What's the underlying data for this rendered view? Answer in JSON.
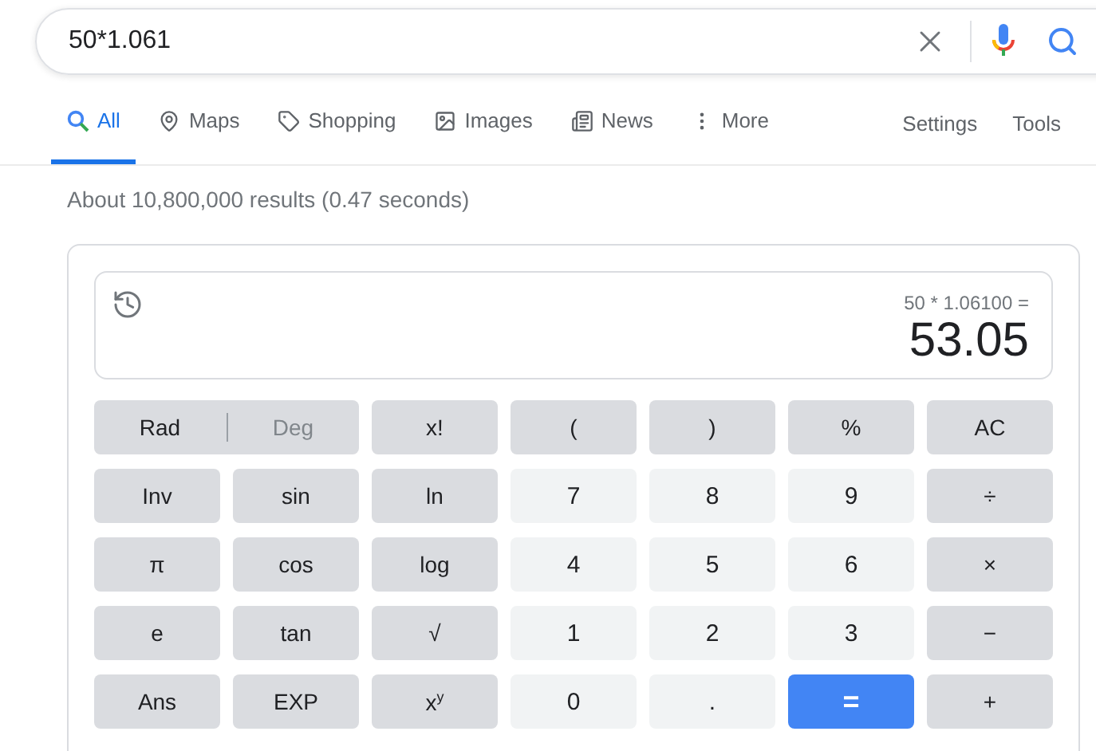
{
  "search": {
    "value": "50*1.061"
  },
  "tabs": [
    {
      "label": "All",
      "kind": "search",
      "selected": true
    },
    {
      "label": "Maps",
      "kind": "pin",
      "selected": false
    },
    {
      "label": "Shopping",
      "kind": "tag",
      "selected": false
    },
    {
      "label": "Images",
      "kind": "image",
      "selected": false
    },
    {
      "label": "News",
      "kind": "news",
      "selected": false
    },
    {
      "label": "More",
      "kind": "dots",
      "selected": false
    }
  ],
  "tools": [
    "Settings",
    "Tools"
  ],
  "result_stats": "About 10,800,000 results (0.47 seconds)",
  "calculator": {
    "expression": "50 * 1.06100 =",
    "result": "53.05",
    "keys": [
      {
        "kind": "angle",
        "options": [
          {
            "label": "Rad",
            "selected": true
          },
          {
            "label": "Deg",
            "selected": false
          }
        ]
      },
      {
        "kind": "fn",
        "label": "x!"
      },
      {
        "kind": "fn",
        "label": "("
      },
      {
        "kind": "fn",
        "label": ")"
      },
      {
        "kind": "fn",
        "label": "%"
      },
      {
        "kind": "fn",
        "label": "AC"
      },
      {
        "kind": "fn",
        "label": "Inv"
      },
      {
        "kind": "fn",
        "label": "sin"
      },
      {
        "kind": "fn",
        "label": "ln"
      },
      {
        "kind": "num",
        "label": "7"
      },
      {
        "kind": "num",
        "label": "8"
      },
      {
        "kind": "num",
        "label": "9"
      },
      {
        "kind": "fn",
        "label": "÷"
      },
      {
        "kind": "fn",
        "label": "π"
      },
      {
        "kind": "fn",
        "label": "cos"
      },
      {
        "kind": "fn",
        "label": "log"
      },
      {
        "kind": "num",
        "label": "4"
      },
      {
        "kind": "num",
        "label": "5"
      },
      {
        "kind": "num",
        "label": "6"
      },
      {
        "kind": "fn",
        "label": "×"
      },
      {
        "kind": "fn",
        "label": "e"
      },
      {
        "kind": "fn",
        "label": "tan"
      },
      {
        "kind": "fn",
        "label": "√"
      },
      {
        "kind": "num",
        "label": "1"
      },
      {
        "kind": "num",
        "label": "2"
      },
      {
        "kind": "num",
        "label": "3"
      },
      {
        "kind": "fn",
        "label": "−"
      },
      {
        "kind": "fn",
        "label": "Ans"
      },
      {
        "kind": "fn",
        "label": "EXP"
      },
      {
        "kind": "fn",
        "label": "x$^{y}$"
      },
      {
        "kind": "num",
        "label": "0"
      },
      {
        "kind": "num",
        "label": "."
      },
      {
        "kind": "equals",
        "label": "="
      },
      {
        "kind": "fn",
        "label": "+"
      }
    ]
  }
}
